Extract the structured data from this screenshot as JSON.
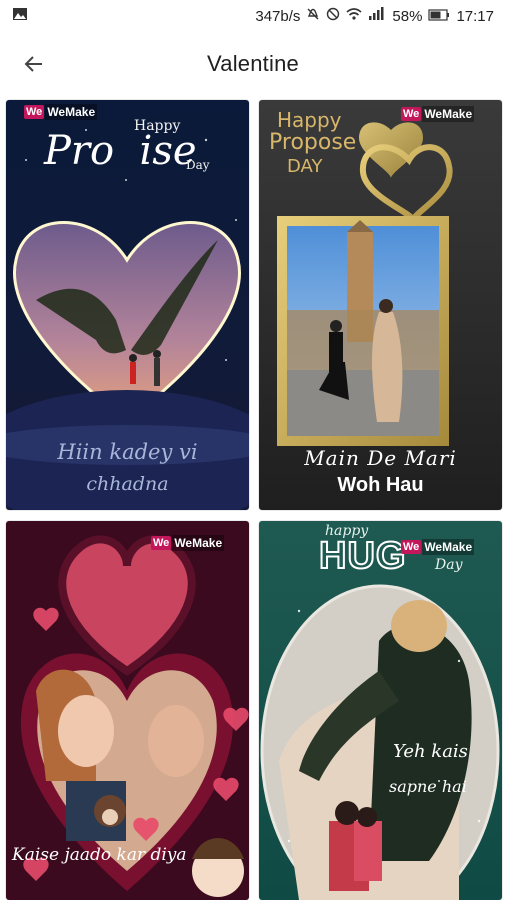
{
  "status": {
    "left_icon": "image-icon",
    "speed": "347b/s",
    "battery": "58%",
    "time": "17:17"
  },
  "appbar": {
    "title": "Valentine",
    "back_icon": "arrow-left-icon"
  },
  "cards": [
    {
      "watermark": "WeMake",
      "watermark_badge": "We",
      "headline_small_top": "Happy",
      "headline_big": "Pro  ise",
      "headline_small_bottom": "Day",
      "caption_line1": "Hiin kadey vi",
      "caption_line2": "chhadna"
    },
    {
      "watermark": "WeMake",
      "watermark_badge": "We",
      "headline_line1": "Happy",
      "headline_line2": "Propose",
      "headline_line3": "DAY",
      "caption_line1": "Main De Mari",
      "caption_line2": "Woh Hau"
    },
    {
      "watermark": "WeMake",
      "watermark_badge": "We",
      "caption_line1": "Kaise jaado kar diya"
    },
    {
      "watermark": "WeMake",
      "watermark_badge": "We",
      "headline_small_top": "happy",
      "headline_big": "HUG",
      "headline_small_bottom": "Day",
      "caption_line1": "Yeh kais",
      "caption_line2": "sapne hai"
    }
  ]
}
